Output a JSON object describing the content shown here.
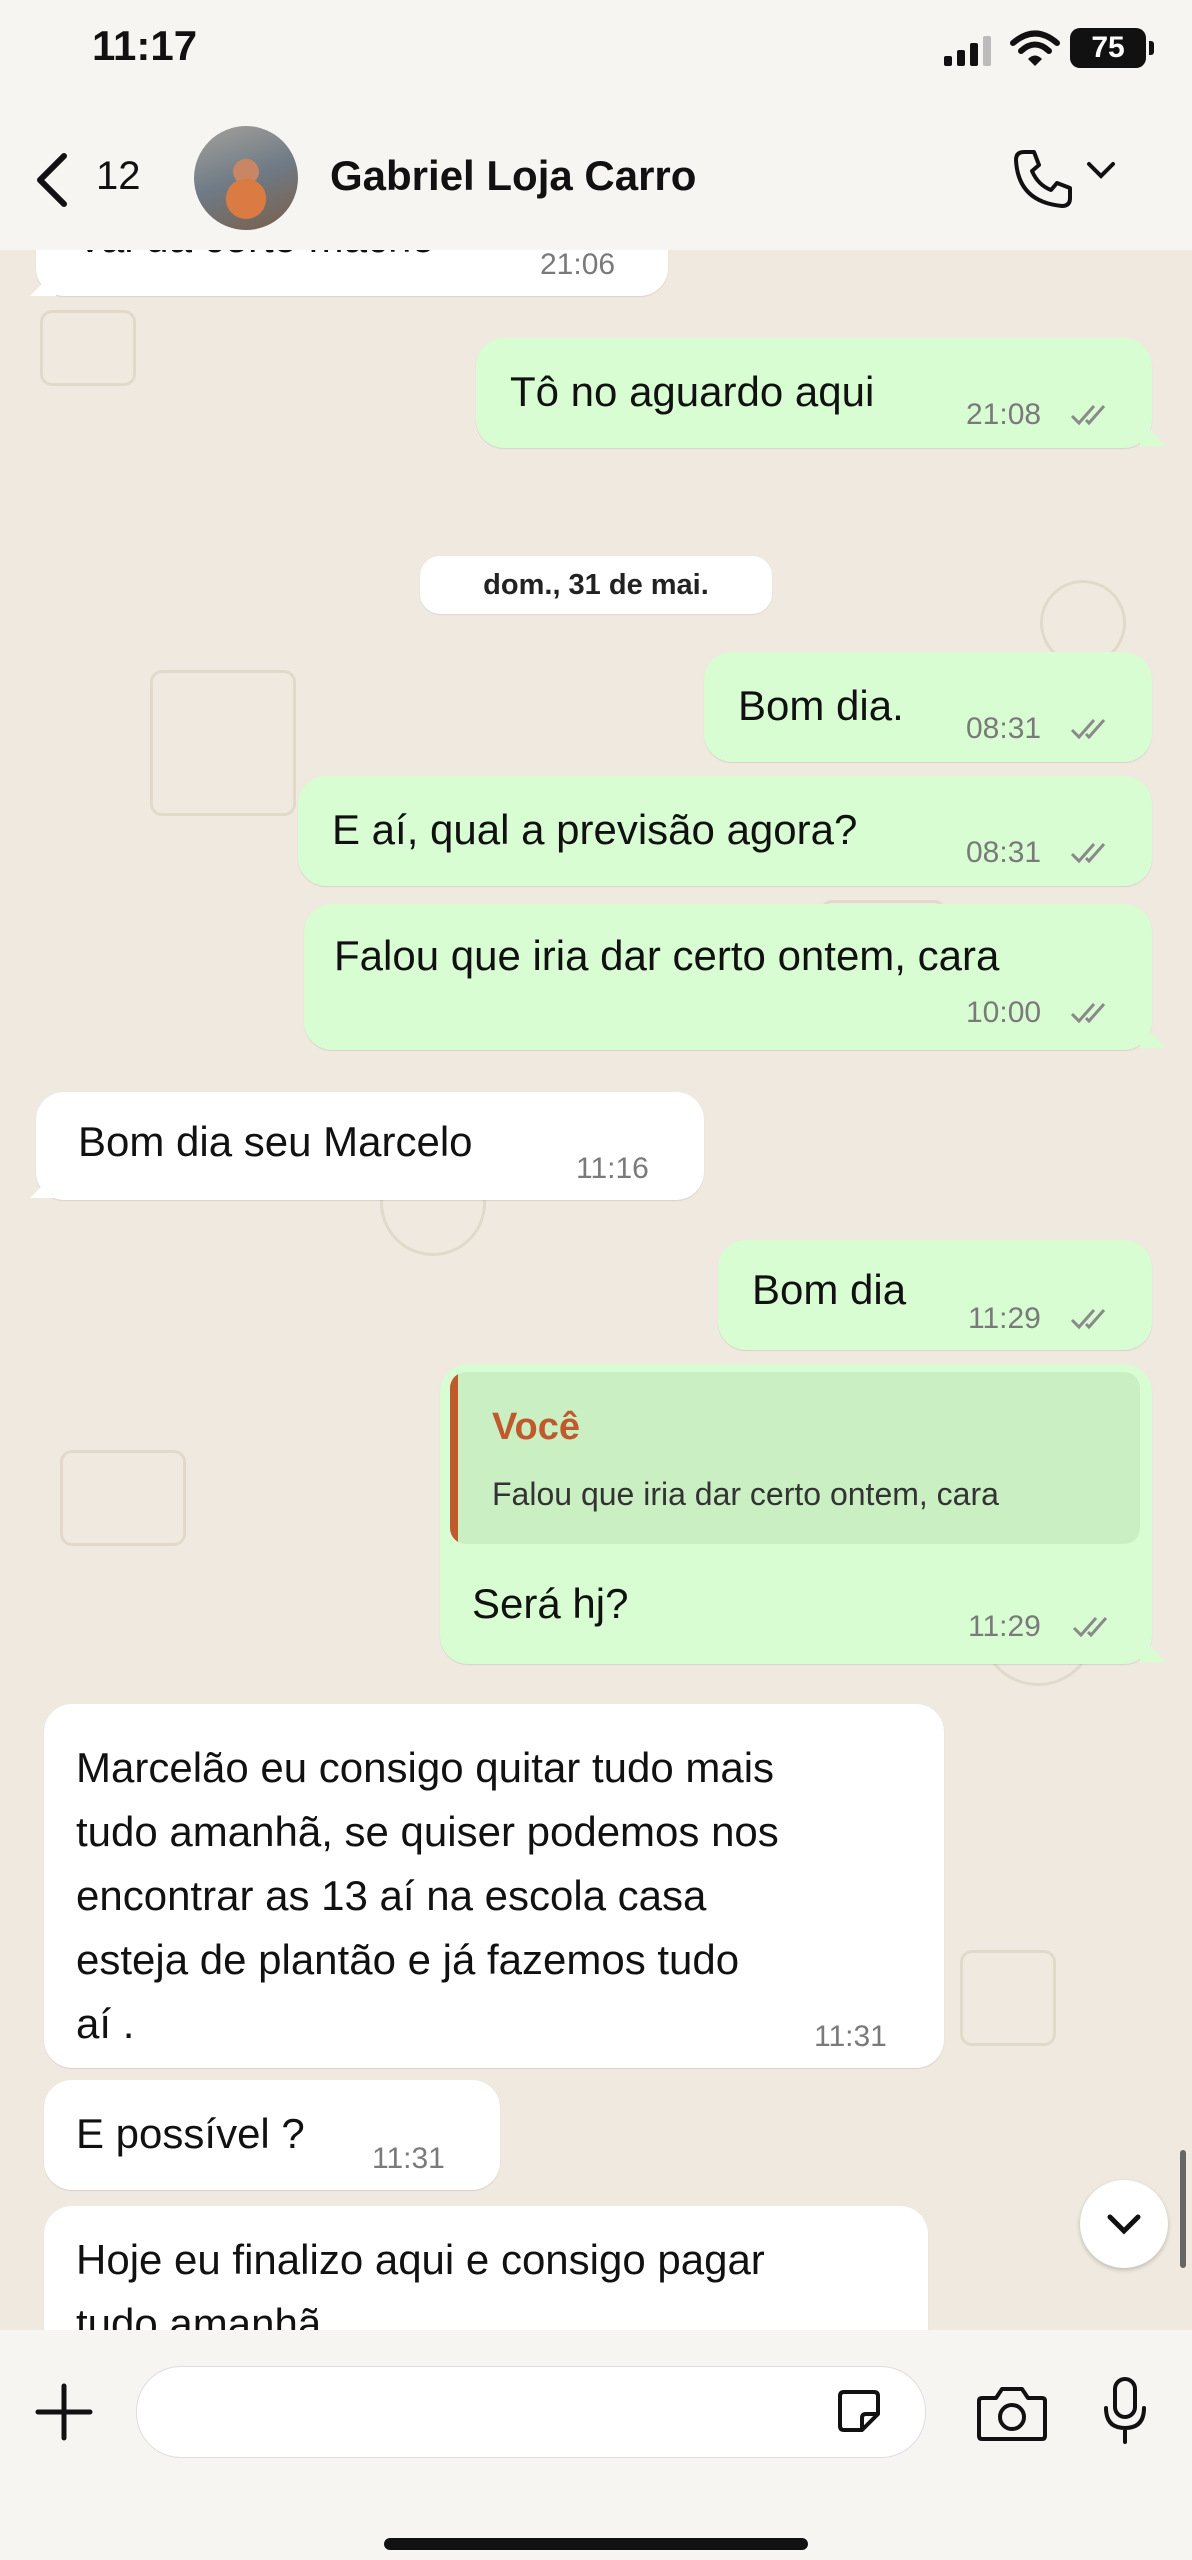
{
  "status_bar": {
    "time": "11:17",
    "battery": "75"
  },
  "header": {
    "back_count": "12",
    "contact_name": "Gabriel Loja Carro"
  },
  "date_separator": "dom., 31 de mai.",
  "messages": [
    {
      "dir": "in",
      "text": "Vai da certo macho",
      "time": "21:06"
    },
    {
      "dir": "out",
      "text": "Tô no aguardo aqui",
      "time": "21:08",
      "read": true
    },
    {
      "dir": "out",
      "text": "Bom dia.",
      "time": "08:31",
      "read": true
    },
    {
      "dir": "out",
      "text": "E aí, qual a previsão agora?",
      "time": "08:31",
      "read": true
    },
    {
      "dir": "out",
      "text": "Falou que iria dar certo ontem, cara",
      "time": "10:00",
      "read": true
    },
    {
      "dir": "in",
      "text": "Bom dia seu Marcelo",
      "time": "11:16"
    },
    {
      "dir": "out",
      "text": "Bom dia",
      "time": "11:29",
      "read": true
    },
    {
      "dir": "out",
      "reply_author": "Você",
      "reply_text": "Falou que iria dar certo ontem, cara",
      "text": "Será hj?",
      "time": "11:29",
      "read": true
    },
    {
      "dir": "in",
      "lines": [
        "Marcelão eu consigo quitar tudo mais",
        "tudo amanhã, se quiser podemos nos",
        "encontrar as 13 aí na escola casa",
        "esteja de plantão e já fazemos tudo",
        "aí ."
      ],
      "time": "11:31"
    },
    {
      "dir": "in",
      "text": "E possível ?",
      "time": "11:31"
    },
    {
      "dir": "in",
      "lines": [
        "Hoje eu finalizo aqui e consigo pagar",
        "tudo amanhã"
      ]
    }
  ],
  "colors": {
    "outgoing_bubble": "#d9fdd3",
    "incoming_bubble": "#ffffff",
    "wallpaper": "#efe9df",
    "reply_accent": "#c0592b",
    "read_ticks": "#8a8a8a"
  },
  "icons": [
    "back-chevron-icon",
    "phone-icon",
    "chevron-down-icon",
    "plus-icon",
    "sticker-icon",
    "camera-icon",
    "microphone-icon",
    "scroll-down-icon"
  ]
}
